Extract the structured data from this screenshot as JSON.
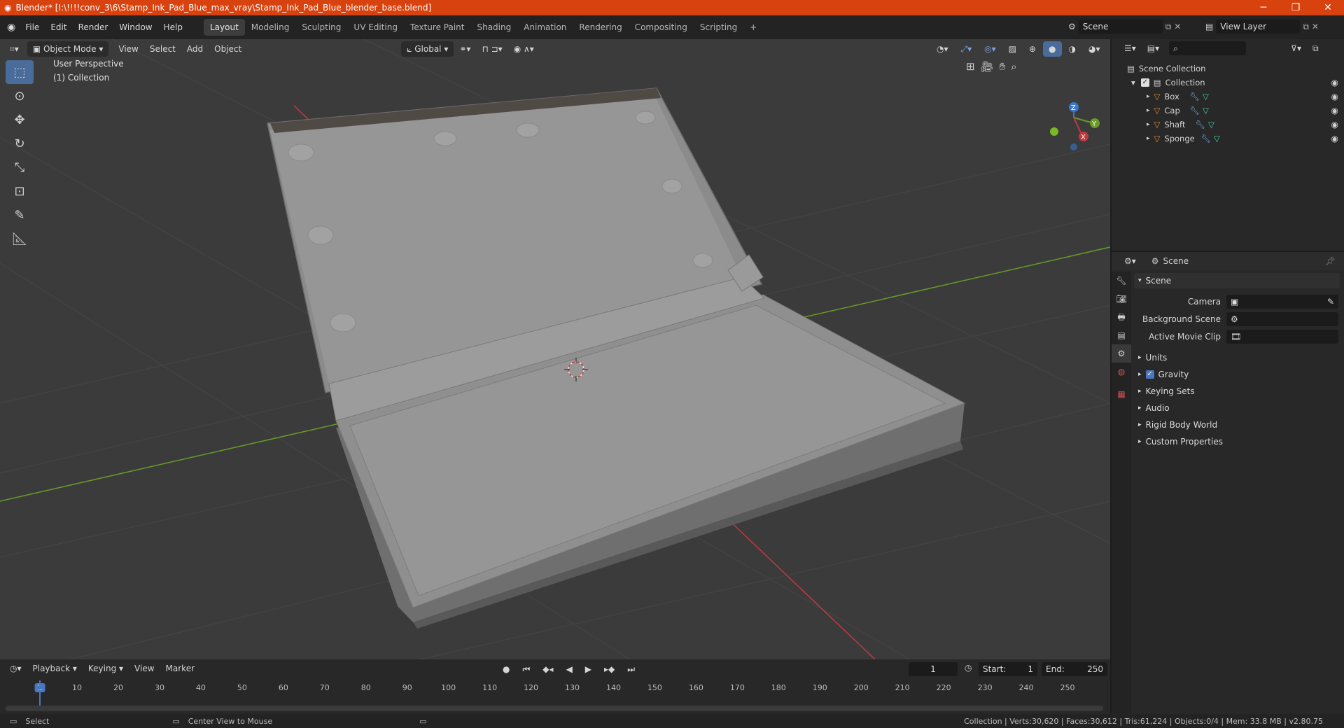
{
  "window": {
    "title": "Blender* [I:\\!!!!conv_3\\6\\Stamp_Ink_Pad_Blue_max_vray\\Stamp_Ink_Pad_Blue_blender_base.blend]",
    "minimize": "─",
    "maximize": "❐",
    "close": "✕"
  },
  "menus": [
    "File",
    "Edit",
    "Render",
    "Window",
    "Help"
  ],
  "workspaces": [
    "Layout",
    "Modeling",
    "Sculpting",
    "UV Editing",
    "Texture Paint",
    "Shading",
    "Animation",
    "Rendering",
    "Compositing",
    "Scripting"
  ],
  "active_workspace": "Layout",
  "add_workspace": "+",
  "scene_field": "Scene",
  "view_layer_field": "View Layer",
  "viewport_header": {
    "mode": "Object Mode",
    "menus": [
      "View",
      "Select",
      "Add",
      "Object"
    ],
    "orientation": "Global"
  },
  "viewport_overlay": {
    "perspective": "User Perspective",
    "collection": "(1) Collection"
  },
  "gizmo": {
    "x": "X",
    "y": "Y",
    "z": "Z"
  },
  "outliner": {
    "root": "Scene Collection",
    "collection": "Collection",
    "objects": [
      "Box",
      "Cap",
      "Shaft",
      "Sponge"
    ]
  },
  "properties": {
    "context_title": "Scene",
    "panel_title": "Scene",
    "fields": [
      {
        "label": "Camera",
        "value": ""
      },
      {
        "label": "Background Scene",
        "value": ""
      },
      {
        "label": "Active Movie Clip",
        "value": ""
      }
    ],
    "subpanels": [
      "Units",
      "Gravity",
      "Keying Sets",
      "Audio",
      "Rigid Body World",
      "Custom Properties"
    ],
    "gravity_checked": true
  },
  "timeline": {
    "menus": [
      "Playback",
      "Keying",
      "View",
      "Marker"
    ],
    "current_frame": "1",
    "start_label": "Start:",
    "start_value": "1",
    "end_label": "End:",
    "end_value": "250",
    "ticks": [
      "1",
      "10",
      "20",
      "30",
      "40",
      "50",
      "60",
      "70",
      "80",
      "90",
      "100",
      "110",
      "120",
      "130",
      "140",
      "150",
      "160",
      "170",
      "180",
      "190",
      "200",
      "210",
      "220",
      "230",
      "240",
      "250"
    ]
  },
  "statusbar": {
    "left_action": "Select",
    "middle_action": "Center View to Mouse",
    "stats": "Collection | Verts:30,620 | Faces:30,612 | Tris:61,224 | Objects:0/4 | Mem: 33.8 MB | v2.80.75"
  },
  "colors": {
    "title_bar": "#d8420f",
    "viewport_bg": "#3b3b3b",
    "panel_bg": "#282828",
    "active_tool": "#4a6c9a",
    "x_axis": "#c2383f",
    "y_axis": "#6a9a2a",
    "z_axis": "#3a76c9",
    "mesh_orange": "#e38a2e"
  }
}
